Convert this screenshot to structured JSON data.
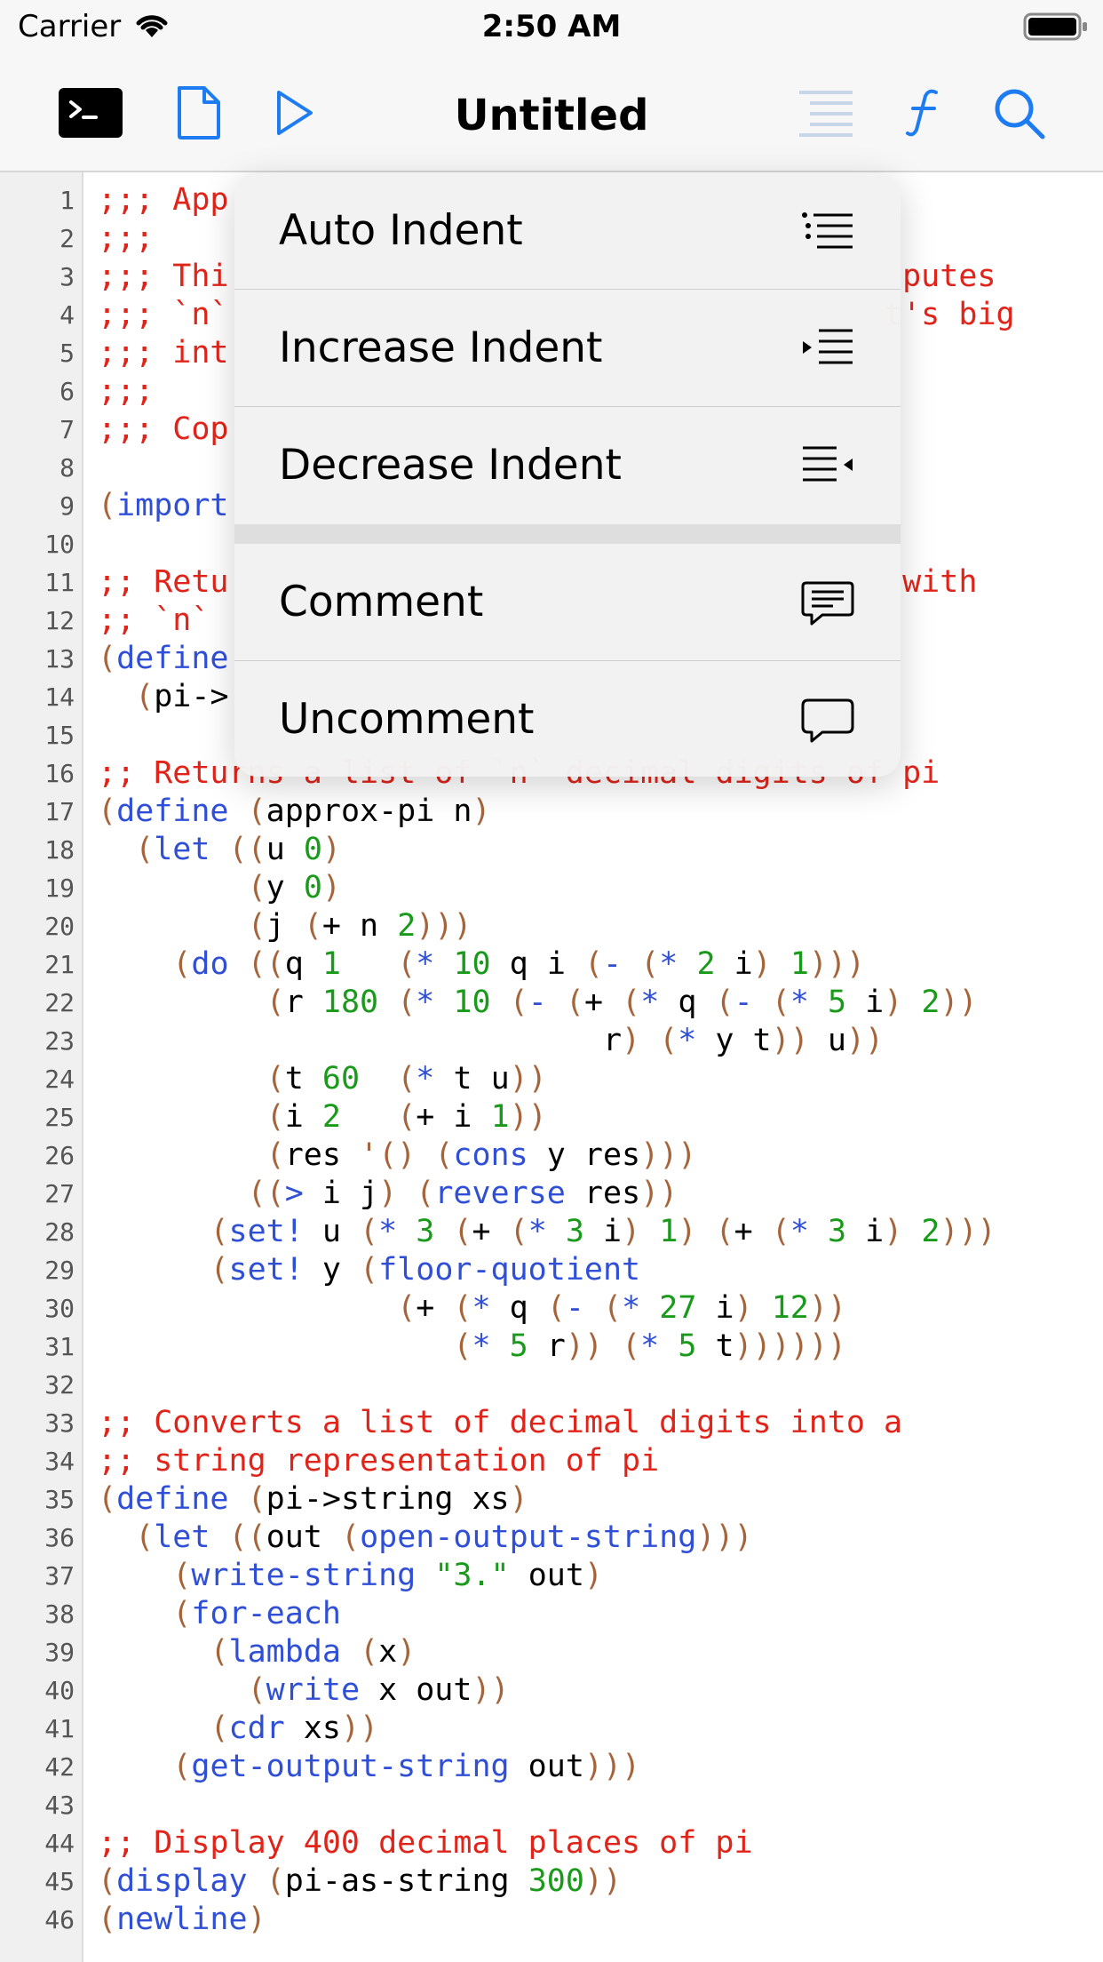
{
  "status_bar": {
    "carrier": "Carrier",
    "time": "2:50 AM"
  },
  "nav_bar": {
    "title": "Untitled"
  },
  "menu": {
    "items": [
      {
        "label": "Auto Indent",
        "icon": "auto-indent-icon"
      },
      {
        "label": "Increase Indent",
        "icon": "increase-indent-icon"
      },
      {
        "label": "Decrease Indent",
        "icon": "decrease-indent-icon"
      },
      {
        "label": "Comment",
        "icon": "comment-icon"
      },
      {
        "label": "Uncomment",
        "icon": "uncomment-icon"
      }
    ]
  },
  "editor": {
    "line_numbers": [
      "1",
      "2",
      "3",
      "4",
      "5",
      "6",
      "7",
      "8",
      "9",
      "10",
      "11",
      "12",
      "13",
      "14",
      "15",
      "16",
      "17",
      "18",
      "19",
      "20",
      "21",
      "22",
      "23",
      "24",
      "25",
      "26",
      "27",
      "28",
      "29",
      "30",
      "31",
      "32",
      "33",
      "34",
      "35",
      "36",
      "37",
      "38",
      "39",
      "40",
      "41",
      "42",
      "43",
      "44",
      "45",
      "46"
    ],
    "lines": [
      [
        [
          ";;; App",
          "c"
        ]
      ],
      [
        [
          ";;;",
          "c"
        ]
      ],
      [
        [
          ";;; Thi",
          "c"
        ],
        [
          "                                    putes",
          "c"
        ]
      ],
      [
        [
          ";;; `n`",
          "c"
        ],
        [
          "                                   t's big",
          "c"
        ]
      ],
      [
        [
          ";;; int",
          "c"
        ]
      ],
      [
        [
          ";;;",
          "c"
        ]
      ],
      [
        [
          ";;; Cop",
          "c"
        ]
      ],
      [],
      [
        [
          "(",
          "p"
        ],
        [
          "import",
          "k"
        ]
      ],
      [],
      [
        [
          ";; Retu",
          "c"
        ],
        [
          "                                    with",
          "c"
        ]
      ],
      [
        [
          ";; `n` ",
          "c"
        ]
      ],
      [
        [
          "(",
          "p"
        ],
        [
          "define",
          "k"
        ]
      ],
      [
        [
          "  ",
          "t"
        ],
        [
          "(",
          "p"
        ],
        [
          "pi->",
          "t"
        ]
      ],
      [],
      [
        [
          ";; Returns a list of `n` decimal digits of pi",
          "c"
        ]
      ],
      [
        [
          "(",
          "p"
        ],
        [
          "define",
          "k"
        ],
        [
          " ",
          "t"
        ],
        [
          "(",
          "p"
        ],
        [
          "approx-pi n",
          "t"
        ],
        [
          ")",
          "p"
        ]
      ],
      [
        [
          "  ",
          "t"
        ],
        [
          "(",
          "p"
        ],
        [
          "let",
          "k"
        ],
        [
          " ",
          "t"
        ],
        [
          "((",
          "p"
        ],
        [
          "u ",
          "t"
        ],
        [
          "0",
          "n"
        ],
        [
          ")",
          "p"
        ]
      ],
      [
        [
          "        ",
          "t"
        ],
        [
          "(",
          "p"
        ],
        [
          "y ",
          "t"
        ],
        [
          "0",
          "n"
        ],
        [
          ")",
          "p"
        ]
      ],
      [
        [
          "        ",
          "t"
        ],
        [
          "(",
          "p"
        ],
        [
          "j ",
          "t"
        ],
        [
          "(",
          "p"
        ],
        [
          "+ n ",
          "t"
        ],
        [
          "2",
          "n"
        ],
        [
          ")))",
          "p"
        ]
      ],
      [
        [
          "    ",
          "t"
        ],
        [
          "(",
          "p"
        ],
        [
          "do",
          "k"
        ],
        [
          " ",
          "t"
        ],
        [
          "((",
          "p"
        ],
        [
          "q ",
          "t"
        ],
        [
          "1",
          "n"
        ],
        [
          "   ",
          "t"
        ],
        [
          "(",
          "p"
        ],
        [
          "* ",
          "k"
        ],
        [
          "10",
          "n"
        ],
        [
          " q i ",
          "t"
        ],
        [
          "(",
          "p"
        ],
        [
          "- ",
          "k"
        ],
        [
          "(",
          "p"
        ],
        [
          "* ",
          "k"
        ],
        [
          "2",
          "n"
        ],
        [
          " i",
          "t"
        ],
        [
          ")",
          "p"
        ],
        [
          " ",
          "t"
        ],
        [
          "1",
          "n"
        ],
        [
          ")))",
          "p"
        ]
      ],
      [
        [
          "         ",
          "t"
        ],
        [
          "(",
          "p"
        ],
        [
          "r ",
          "t"
        ],
        [
          "180",
          "n"
        ],
        [
          " ",
          "t"
        ],
        [
          "(",
          "p"
        ],
        [
          "* ",
          "k"
        ],
        [
          "10",
          "n"
        ],
        [
          " ",
          "t"
        ],
        [
          "(",
          "p"
        ],
        [
          "- ",
          "k"
        ],
        [
          "(",
          "p"
        ],
        [
          "+ ",
          "t"
        ],
        [
          "(",
          "p"
        ],
        [
          "* ",
          "k"
        ],
        [
          "q ",
          "t"
        ],
        [
          "(",
          "p"
        ],
        [
          "- ",
          "k"
        ],
        [
          "(",
          "p"
        ],
        [
          "* ",
          "k"
        ],
        [
          "5",
          "n"
        ],
        [
          " i",
          "t"
        ],
        [
          ")",
          "p"
        ],
        [
          " ",
          "t"
        ],
        [
          "2",
          "n"
        ],
        [
          "))",
          "p"
        ]
      ],
      [
        [
          "                           r",
          "t"
        ],
        [
          ")",
          "p"
        ],
        [
          " ",
          "t"
        ],
        [
          "(",
          "p"
        ],
        [
          "* ",
          "k"
        ],
        [
          "y t",
          "t"
        ],
        [
          "))",
          "p"
        ],
        [
          " u",
          "t"
        ],
        [
          "))",
          "p"
        ]
      ],
      [
        [
          "         ",
          "t"
        ],
        [
          "(",
          "p"
        ],
        [
          "t ",
          "t"
        ],
        [
          "60",
          "n"
        ],
        [
          "  ",
          "t"
        ],
        [
          "(",
          "p"
        ],
        [
          "* ",
          "k"
        ],
        [
          "t u",
          "t"
        ],
        [
          "))",
          "p"
        ]
      ],
      [
        [
          "         ",
          "t"
        ],
        [
          "(",
          "p"
        ],
        [
          "i ",
          "t"
        ],
        [
          "2",
          "n"
        ],
        [
          "   ",
          "t"
        ],
        [
          "(",
          "p"
        ],
        [
          "+ i ",
          "t"
        ],
        [
          "1",
          "n"
        ],
        [
          "))",
          "p"
        ]
      ],
      [
        [
          "         ",
          "t"
        ],
        [
          "(",
          "p"
        ],
        [
          "res ",
          "t"
        ],
        [
          "'()",
          "p"
        ],
        [
          " ",
          "t"
        ],
        [
          "(",
          "p"
        ],
        [
          "cons",
          "k"
        ],
        [
          " y res",
          "t"
        ],
        [
          ")))",
          "p"
        ]
      ],
      [
        [
          "        ",
          "t"
        ],
        [
          "((",
          "p"
        ],
        [
          "> ",
          "k"
        ],
        [
          "i j",
          "t"
        ],
        [
          ")",
          "p"
        ],
        [
          " ",
          "t"
        ],
        [
          "(",
          "p"
        ],
        [
          "reverse",
          "k"
        ],
        [
          " res",
          "t"
        ],
        [
          "))",
          "p"
        ]
      ],
      [
        [
          "      ",
          "t"
        ],
        [
          "(",
          "p"
        ],
        [
          "set!",
          "k"
        ],
        [
          " u ",
          "t"
        ],
        [
          "(",
          "p"
        ],
        [
          "* ",
          "k"
        ],
        [
          "3",
          "n"
        ],
        [
          " ",
          "t"
        ],
        [
          "(",
          "p"
        ],
        [
          "+ ",
          "t"
        ],
        [
          "(",
          "p"
        ],
        [
          "* ",
          "k"
        ],
        [
          "3",
          "n"
        ],
        [
          " i",
          "t"
        ],
        [
          ")",
          "p"
        ],
        [
          " ",
          "t"
        ],
        [
          "1",
          "n"
        ],
        [
          ")",
          "p"
        ],
        [
          " ",
          "t"
        ],
        [
          "(",
          "p"
        ],
        [
          "+ ",
          "t"
        ],
        [
          "(",
          "p"
        ],
        [
          "* ",
          "k"
        ],
        [
          "3",
          "n"
        ],
        [
          " i",
          "t"
        ],
        [
          ")",
          "p"
        ],
        [
          " ",
          "t"
        ],
        [
          "2",
          "n"
        ],
        [
          ")))",
          "p"
        ]
      ],
      [
        [
          "      ",
          "t"
        ],
        [
          "(",
          "p"
        ],
        [
          "set!",
          "k"
        ],
        [
          " y ",
          "t"
        ],
        [
          "(",
          "p"
        ],
        [
          "floor-quotient",
          "k"
        ]
      ],
      [
        [
          "                ",
          "t"
        ],
        [
          "(",
          "p"
        ],
        [
          "+ ",
          "t"
        ],
        [
          "(",
          "p"
        ],
        [
          "* ",
          "k"
        ],
        [
          "q ",
          "t"
        ],
        [
          "(",
          "p"
        ],
        [
          "- ",
          "k"
        ],
        [
          "(",
          "p"
        ],
        [
          "* ",
          "k"
        ],
        [
          "27",
          "n"
        ],
        [
          " i",
          "t"
        ],
        [
          ")",
          "p"
        ],
        [
          " ",
          "t"
        ],
        [
          "12",
          "n"
        ],
        [
          "))",
          "p"
        ]
      ],
      [
        [
          "                   ",
          "t"
        ],
        [
          "(",
          "p"
        ],
        [
          "* ",
          "k"
        ],
        [
          "5",
          "n"
        ],
        [
          " r",
          "t"
        ],
        [
          "))",
          "p"
        ],
        [
          " ",
          "t"
        ],
        [
          "(",
          "p"
        ],
        [
          "* ",
          "k"
        ],
        [
          "5",
          "n"
        ],
        [
          " t",
          "t"
        ],
        [
          "))))))",
          "p"
        ]
      ],
      [],
      [
        [
          ";; Converts a list of decimal digits into a",
          "c"
        ]
      ],
      [
        [
          ";; string representation of pi",
          "c"
        ]
      ],
      [
        [
          "(",
          "p"
        ],
        [
          "define",
          "k"
        ],
        [
          " ",
          "t"
        ],
        [
          "(",
          "p"
        ],
        [
          "pi->string xs",
          "t"
        ],
        [
          ")",
          "p"
        ]
      ],
      [
        [
          "  ",
          "t"
        ],
        [
          "(",
          "p"
        ],
        [
          "let",
          "k"
        ],
        [
          " ",
          "t"
        ],
        [
          "((",
          "p"
        ],
        [
          "out ",
          "t"
        ],
        [
          "(",
          "p"
        ],
        [
          "open-output-string",
          "k"
        ],
        [
          ")))",
          "p"
        ]
      ],
      [
        [
          "    ",
          "t"
        ],
        [
          "(",
          "p"
        ],
        [
          "write-string",
          "k"
        ],
        [
          " ",
          "t"
        ],
        [
          "\"3.\"",
          "s"
        ],
        [
          " out",
          "t"
        ],
        [
          ")",
          "p"
        ]
      ],
      [
        [
          "    ",
          "t"
        ],
        [
          "(",
          "p"
        ],
        [
          "for-each",
          "k"
        ]
      ],
      [
        [
          "      ",
          "t"
        ],
        [
          "(",
          "p"
        ],
        [
          "lambda",
          "k"
        ],
        [
          " ",
          "t"
        ],
        [
          "(",
          "p"
        ],
        [
          "x",
          "t"
        ],
        [
          ")",
          "p"
        ]
      ],
      [
        [
          "        ",
          "t"
        ],
        [
          "(",
          "p"
        ],
        [
          "write",
          "k"
        ],
        [
          " x out",
          "t"
        ],
        [
          "))",
          "p"
        ]
      ],
      [
        [
          "      ",
          "t"
        ],
        [
          "(",
          "p"
        ],
        [
          "cdr",
          "k"
        ],
        [
          " xs",
          "t"
        ],
        [
          "))",
          "p"
        ]
      ],
      [
        [
          "    ",
          "t"
        ],
        [
          "(",
          "p"
        ],
        [
          "get-output-string",
          "k"
        ],
        [
          " out",
          "t"
        ],
        [
          ")))",
          "p"
        ]
      ],
      [],
      [
        [
          ";; Display 400 decimal places of pi",
          "c"
        ]
      ],
      [
        [
          "(",
          "p"
        ],
        [
          "display",
          "k"
        ],
        [
          " ",
          "t"
        ],
        [
          "(",
          "p"
        ],
        [
          "pi-as-string ",
          "t"
        ],
        [
          "300",
          "n"
        ],
        [
          "))",
          "p"
        ]
      ],
      [
        [
          "(",
          "p"
        ],
        [
          "newline",
          "k"
        ],
        [
          ")",
          "p"
        ]
      ]
    ]
  },
  "colors": {
    "comment": "#e0241a",
    "paren": "#a6643a",
    "keyword": "#2f4fd6",
    "number": "#1a9a1a",
    "accent": "#1e7cf2"
  }
}
